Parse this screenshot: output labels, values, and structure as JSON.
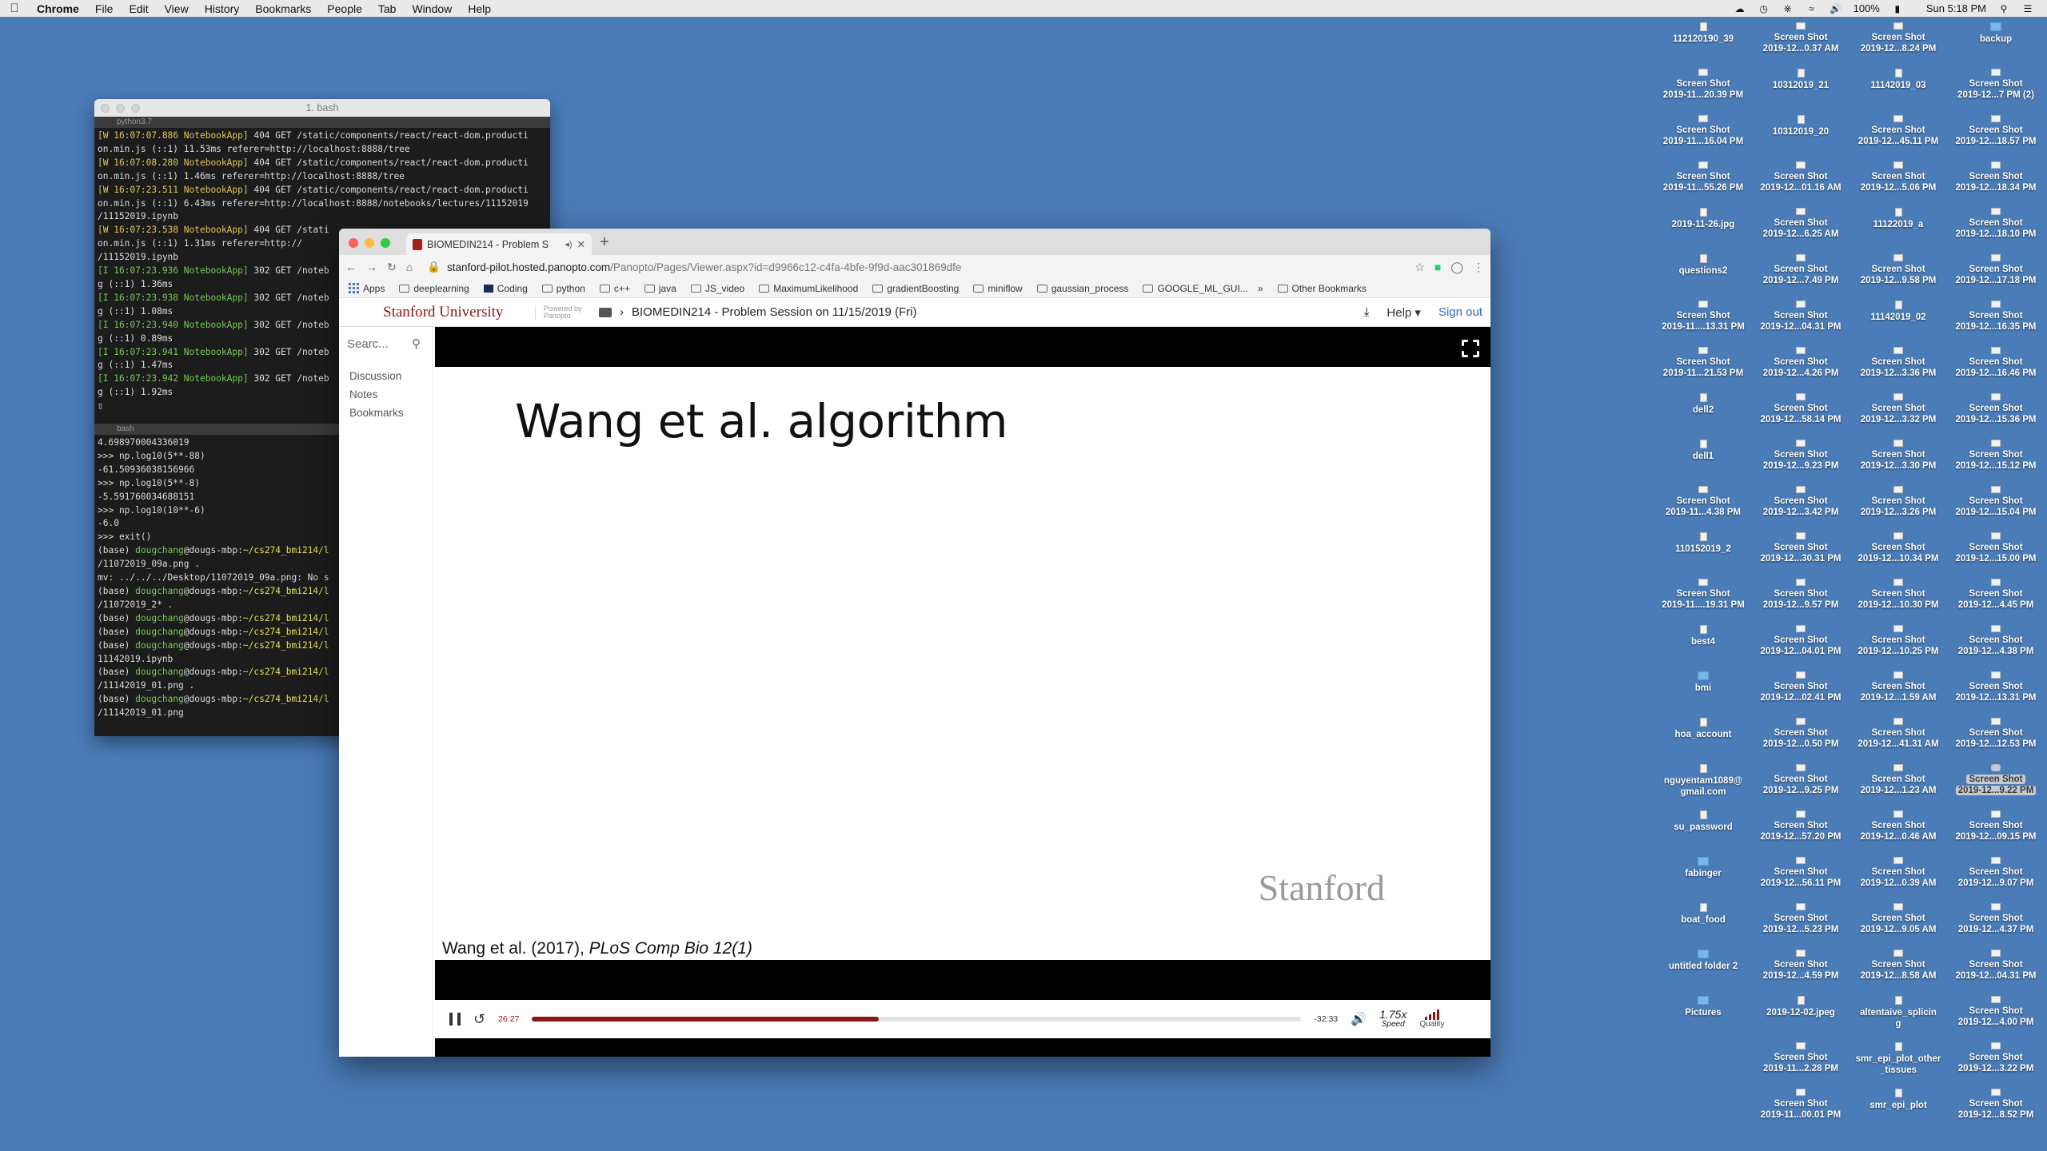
{
  "menubar": {
    "app": "Chrome",
    "items": [
      "File",
      "Edit",
      "View",
      "History",
      "Bookmarks",
      "People",
      "Tab",
      "Window",
      "Help"
    ],
    "battery": "100%",
    "clock": "Sun 5:18 PM"
  },
  "desktop": {
    "col1": [
      [
        "112120190_39",
        ""
      ],
      [
        "Screen Shot",
        "2019-11...20.39 PM"
      ],
      [
        "Screen Shot",
        "2019-11...16.04 PM"
      ],
      [
        "Screen Shot",
        "2019-11...55.26 PM"
      ],
      [
        "2019-11-26.jpg",
        ""
      ],
      [
        "questions2",
        ""
      ],
      [
        "Screen Shot",
        "2019-11....13.31 PM"
      ],
      [
        "Screen Shot",
        "2019-11...21.53 PM"
      ],
      [
        "dell2",
        ""
      ],
      [
        "dell1",
        ""
      ],
      [
        "Screen Shot",
        "2019-11...4.38 PM"
      ],
      [
        "110152019_2",
        ""
      ],
      [
        "Screen Shot",
        "2019-11....19.31 PM"
      ],
      [
        "best4",
        ""
      ],
      [
        "bmi",
        ""
      ],
      [
        "hoa_account",
        ""
      ],
      [
        "nguyentam1089@",
        "gmail.com"
      ],
      [
        "su_password",
        ""
      ],
      [
        "fabinger",
        ""
      ],
      [
        "boat_food",
        ""
      ],
      [
        "untitled folder 2",
        ""
      ],
      [
        "Pictures",
        ""
      ]
    ],
    "col2": [
      [
        "Screen Shot",
        "2019-12...0.37 AM"
      ],
      [
        "10312019_21",
        ""
      ],
      [
        "10312019_20",
        ""
      ],
      [
        "Screen Shot",
        "2019-12...01.16 AM"
      ],
      [
        "Screen Shot",
        "2019-12...6.25 AM"
      ],
      [
        "Screen Shot",
        "2019-12...7.49 PM"
      ],
      [
        "Screen Shot",
        "2019-12...04.31 PM"
      ],
      [
        "Screen Shot",
        "2019-12...4.26 PM"
      ],
      [
        "Screen Shot",
        "2019-12...58.14 PM"
      ],
      [
        "Screen Shot",
        "2019-12...9.23 PM"
      ],
      [
        "Screen Shot",
        "2019-12...3.42 PM"
      ],
      [
        "Screen Shot",
        "2019-12...30.31 PM"
      ],
      [
        "Screen Shot",
        "2019-12...9.57 PM"
      ],
      [
        "Screen Shot",
        "2019-12...04.01 PM"
      ],
      [
        "Screen Shot",
        "2019-12...02.41 PM"
      ],
      [
        "Screen Shot",
        "2019-12...0.50 PM"
      ],
      [
        "Screen Shot",
        "2019-12...9.25 PM"
      ],
      [
        "Screen Shot",
        "2019-12...57.20 PM"
      ],
      [
        "Screen Shot",
        "2019-12...56.11 PM"
      ],
      [
        "Screen Shot",
        "2019-12...5.23 PM"
      ],
      [
        "Screen Shot",
        "2019-12...4.59 PM"
      ],
      [
        "2019-12-02.jpeg",
        ""
      ],
      [
        "Screen Shot",
        "2019-11...2.28 PM"
      ],
      [
        "Screen Shot",
        "2019-11...00.01 PM"
      ]
    ],
    "col3": [
      [
        "Screen Shot",
        "2019-12...8.24 PM"
      ],
      [
        "11142019_03",
        ""
      ],
      [
        "Screen Shot",
        "2019-12...45.11 PM"
      ],
      [
        "Screen Shot",
        "2019-12...5.06 PM"
      ],
      [
        "11122019_a",
        ""
      ],
      [
        "Screen Shot",
        "2019-12...9.58 PM"
      ],
      [
        "11142019_02",
        ""
      ],
      [
        "Screen Shot",
        "2019-12...3.36 PM"
      ],
      [
        "Screen Shot",
        "2019-12...3.32 PM"
      ],
      [
        "Screen Shot",
        "2019-12...3.30 PM"
      ],
      [
        "Screen Shot",
        "2019-12...3.26 PM"
      ],
      [
        "Screen Shot",
        "2019-12...10.34 PM"
      ],
      [
        "Screen Shot",
        "2019-12...10.30 PM"
      ],
      [
        "Screen Shot",
        "2019-12...10.25 PM"
      ],
      [
        "Screen Shot",
        "2019-12...1.59 AM"
      ],
      [
        "Screen Shot",
        "2019-12...41.31 AM"
      ],
      [
        "Screen Shot",
        "2019-12...1.23 AM"
      ],
      [
        "Screen Shot",
        "2019-12...0.46 AM"
      ],
      [
        "Screen Shot",
        "2019-12...0.39 AM"
      ],
      [
        "Screen Shot",
        "2019-12...9.05 AM"
      ],
      [
        "Screen Shot",
        "2019-12...8.58 AM"
      ],
      [
        "altentaive_splicin",
        "g"
      ],
      [
        "smr_epi_plot_other",
        "_tissues"
      ],
      [
        "smr_epi_plot",
        ""
      ]
    ],
    "col4": [
      [
        "backup",
        ""
      ],
      [
        "Screen Shot",
        "2019-12...7 PM (2)"
      ],
      [
        "Screen Shot",
        "2019-12...18.57 PM"
      ],
      [
        "Screen Shot",
        "2019-12...18.34 PM"
      ],
      [
        "Screen Shot",
        "2019-12...18.10 PM"
      ],
      [
        "Screen Shot",
        "2019-12...17.18 PM"
      ],
      [
        "Screen Shot",
        "2019-12...16.35 PM"
      ],
      [
        "Screen Shot",
        "2019-12...16.46 PM"
      ],
      [
        "Screen Shot",
        "2019-12...15.36 PM"
      ],
      [
        "Screen Shot",
        "2019-12...15.12 PM"
      ],
      [
        "Screen Shot",
        "2019-12...15.04 PM"
      ],
      [
        "Screen Shot",
        "2019-12...15.00 PM"
      ],
      [
        "Screen Shot",
        "2019-12...4.45 PM"
      ],
      [
        "Screen Shot",
        "2019-12...4.38 PM"
      ],
      [
        "Screen Shot",
        "2019-12...13.31 PM"
      ],
      [
        "Screen Shot",
        "2019-12...12.53 PM"
      ],
      [
        "Screen Shot",
        "2019-12...9.22 PM"
      ],
      [
        "Screen Shot",
        "2019-12...09.15 PM"
      ],
      [
        "Screen Shot",
        "2019-12...9.07 PM"
      ],
      [
        "Screen Shot",
        "2019-12...4.37 PM"
      ],
      [
        "Screen Shot",
        "2019-12...04.31 PM"
      ],
      [
        "Screen Shot",
        "2019-12...4.00 PM"
      ],
      [
        "Screen Shot",
        "2019-12...3.22 PM"
      ],
      [
        "Screen Shot",
        "2019-12...8.52 PM"
      ]
    ]
  },
  "terminal": {
    "title": "1. bash",
    "pane1_tab": "python3.7",
    "pane2_tab": "bash",
    "pane1_lines": [
      [
        "[W 16:07:07.886 NotebookApp]",
        "w",
        " 404 GET /static/components/react/react-dom.producti",
        ""
      ],
      [
        "on.min.js (::1) 11.53ms referer=http://localhost:8888/tree",
        "",
        "",
        " "
      ],
      [
        "[W 16:07:08.280 NotebookApp]",
        "w",
        " 404 GET /static/components/react/react-dom.producti",
        ""
      ],
      [
        "on.min.js (::1) 1.46ms referer=http://localhost:8888/tree",
        "",
        "",
        ""
      ],
      [
        "[W 16:07:23.511 NotebookApp]",
        "w",
        " 404 GET /static/components/react/react-dom.producti",
        ""
      ],
      [
        "on.min.js (::1) 6.43ms referer=http://localhost:8888/notebooks/lectures/11152019",
        "",
        "",
        ""
      ],
      [
        "/11152019.ipynb",
        "",
        "",
        ""
      ],
      [
        "[W 16:07:23.538 NotebookApp]",
        "w",
        " 404 GET /stati",
        ""
      ],
      [
        "on.min.js (::1) 1.31ms referer=http://",
        "",
        "",
        ""
      ],
      [
        "/11152019.ipynb",
        "",
        "",
        ""
      ],
      [
        "[I 16:07:23.936 NotebookApp]",
        "ok",
        " 302 GET /noteb",
        ""
      ],
      [
        "g (::1) 1.36ms",
        "",
        "",
        ""
      ],
      [
        "[I 16:07:23.938 NotebookApp]",
        "ok",
        " 302 GET /noteb",
        ""
      ],
      [
        "g (::1) 1.08ms",
        "",
        "",
        ""
      ],
      [
        "[I 16:07:23.940 NotebookApp]",
        "ok",
        " 302 GET /noteb",
        ""
      ],
      [
        "g (::1) 0.89ms",
        "",
        "",
        ""
      ],
      [
        "[I 16:07:23.941 NotebookApp]",
        "ok",
        " 302 GET /noteb",
        ""
      ],
      [
        "g (::1) 1.47ms",
        "",
        "",
        ""
      ],
      [
        "[I 16:07:23.942 NotebookApp]",
        "ok",
        " 302 GET /noteb",
        ""
      ],
      [
        "g (::1) 1.92ms",
        "",
        "",
        ""
      ]
    ],
    "pane2_lines": [
      "4.698970004336019",
      ">>> np.log10(5**-88)",
      "-61.50936038156966",
      ">>> np.log10(5**-8)",
      "-5.591760034688151",
      ">>> np.log10(10**-6)",
      "-6.0",
      ">>> exit()",
      "(base) |dougchang|@dougs-mbp:|~/cs274_bmi214/l",
      "/11072019_09a.png .",
      "mv: ../../../Desktop/11072019_09a.png: No s",
      "(base) |dougchang|@dougs-mbp:|~/cs274_bmi214/l",
      "/11072019_2* .",
      "(base) |dougchang|@dougs-mbp:|~/cs274_bmi214/l",
      "(base) |dougchang|@dougs-mbp:|~/cs274_bmi214/l",
      "(base) |dougchang|@dougs-mbp:|~/cs274_bmi214/l",
      "11142019.ipynb",
      "(base) |dougchang|@dougs-mbp:|~/cs274_bmi214/l",
      "/11142019_01.png .",
      "(base) |dougchang|@dougs-mbp:|~/cs274_bmi214/l",
      "/11142019_01.png "
    ]
  },
  "browser": {
    "tab_title": "BIOMEDIN214 - Problem S",
    "url_host": "stanford-pilot.hosted.panopto.com",
    "url_rest": "/Panopto/Pages/Viewer.aspx?id=d9966c12-c4fa-4bfe-9f9d-aac301869dfe",
    "bookmarks": [
      "Apps",
      "deeplearning",
      "Coding",
      "python",
      "c++",
      "java",
      "JS_video",
      "MaximumLikelihood",
      "gradientBoosting",
      "miniflow",
      "gaussian_process",
      "GOOGLE_ML_GUI..."
    ],
    "other_bookmarks": "Other Bookmarks",
    "more": "»"
  },
  "panopto": {
    "brand": "Stanford University",
    "powered": "Powered by",
    "powered2": "Panopto",
    "breadcrumb": "BIOMEDIN214 - Problem Session on 11/15/2019 (Fri)",
    "help": "Help",
    "signout": "Sign out",
    "search_placeholder": "Searc...",
    "links": [
      "Discussion",
      "Notes",
      "Bookmarks"
    ]
  },
  "slide": {
    "title": "Wang et al. algorithm",
    "logo": "Stanford",
    "cite_plain": "Wang et al. (2017), ",
    "cite_italic": "PLoS Comp Bio 12(1)"
  },
  "player": {
    "current": "26:27",
    "remaining": "-32:33",
    "progress": 0.451,
    "speed": "1.75x",
    "speed_label": "Speed",
    "quality_label": "Quality",
    "accent": "#8c1515"
  }
}
